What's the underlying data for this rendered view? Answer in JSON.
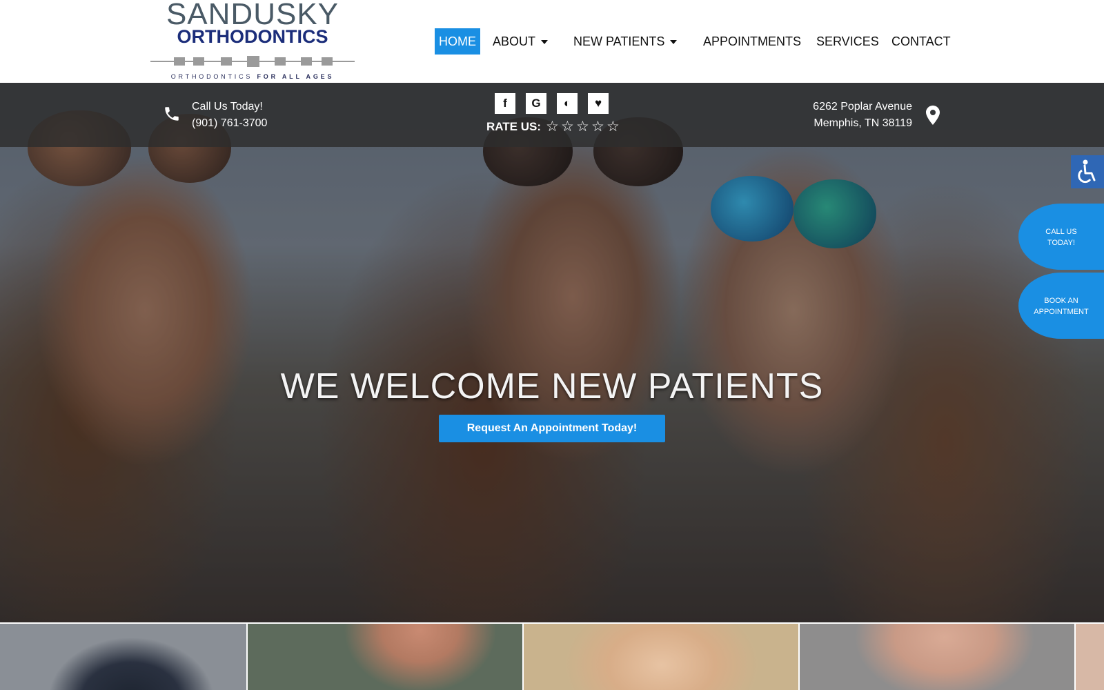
{
  "logo": {
    "line1": "SANDUSKY",
    "line2": "ORTHODONTICS",
    "tagline_a": "ORTHODONTICS ",
    "tagline_b": "FOR ALL AGES"
  },
  "nav": {
    "items": [
      {
        "label": "HOME",
        "active": true
      },
      {
        "label": "ABOUT",
        "dropdown": true
      },
      {
        "label": "NEW PATIENTS",
        "dropdown": true
      },
      {
        "label": "APPOINTMENTS"
      },
      {
        "label": "SERVICES"
      },
      {
        "label": "CONTACT"
      }
    ]
  },
  "infobar": {
    "call_label": "Call Us Today!",
    "phone": "(901) 761-3700",
    "social_icons": [
      "facebook-icon",
      "google-icon",
      "yelp-icon",
      "healthgrades-icon"
    ],
    "social_glyphs": [
      "f",
      "G",
      "◐",
      "♥"
    ],
    "rate_label": "RATE US:",
    "stars": [
      "☆",
      "☆",
      "☆",
      "☆",
      "☆"
    ],
    "address_line1": "6262 Poplar Avenue",
    "address_line2": "Memphis, TN 38119"
  },
  "hero": {
    "title": "WE WELCOME NEW PATIENTS",
    "cta_label": "Request An Appointment Today!"
  },
  "floating": {
    "call_line1": "CALL US",
    "call_line2": "TODAY!",
    "book_line1": "BOOK AN",
    "book_line2": "APPOINTMENT"
  },
  "colors": {
    "accent": "#1a8fe3",
    "logo_navy": "#1b2d7a",
    "logo_gray": "#4a5a66",
    "accessibility_blue": "#2f67b5",
    "infobar": "#2d2d2d"
  }
}
